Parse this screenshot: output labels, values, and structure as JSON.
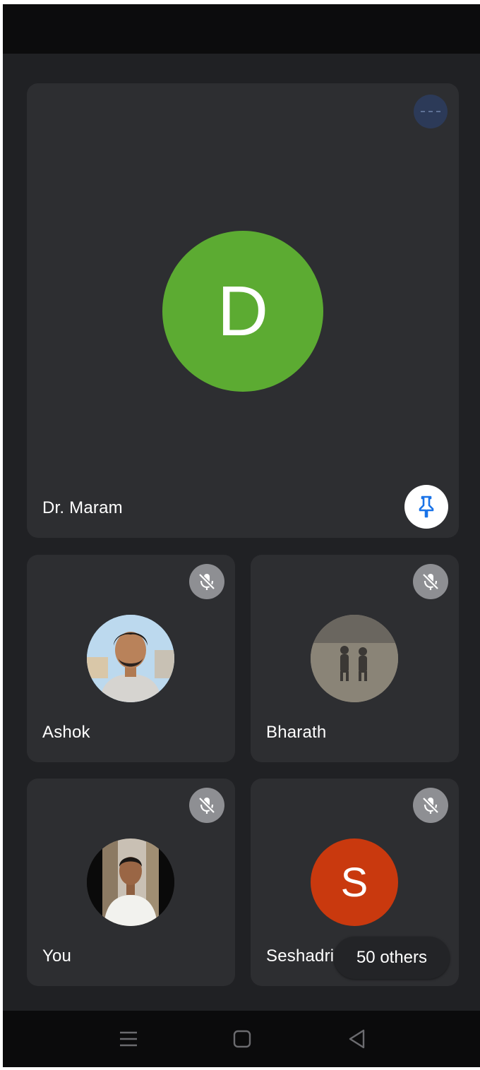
{
  "main_tile": {
    "name": "Dr. Maram",
    "avatar_letter": "D",
    "avatar_color": "#5cab32"
  },
  "participants": [
    {
      "name": "Ashok",
      "muted": true
    },
    {
      "name": "Bharath",
      "muted": true
    },
    {
      "name": "You",
      "muted": true
    },
    {
      "name": "Seshadri",
      "avatar_letter": "S",
      "avatar_color": "#c9390e",
      "muted": true
    }
  ],
  "others_chip": "50 others",
  "colors": {
    "background": "#202124",
    "tile": "#2d2e31",
    "pin_blue": "#1a73e8"
  },
  "icons": {
    "more": "more-options-icon",
    "pin": "pin-icon",
    "mute": "mic-off-icon",
    "nav": [
      "menu-icon",
      "home-icon",
      "back-icon"
    ]
  }
}
